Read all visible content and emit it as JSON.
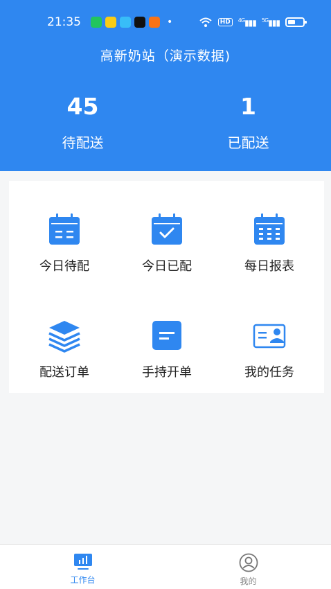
{
  "status_bar": {
    "time": "21:35",
    "dot": "•",
    "signal_1": "4G",
    "signal_2": "5G",
    "hd": "HD"
  },
  "header": {
    "title": "高新奶站（演示数据)",
    "stats": [
      {
        "value": "45",
        "label": "待配送"
      },
      {
        "value": "1",
        "label": "已配送"
      }
    ]
  },
  "grid": {
    "items": [
      {
        "label": "今日待配",
        "icon": "calendar-list-icon"
      },
      {
        "label": "今日已配",
        "icon": "calendar-check-icon"
      },
      {
        "label": "每日报表",
        "icon": "calendar-grid-icon"
      },
      {
        "label": "配送订单",
        "icon": "layers-icon"
      },
      {
        "label": "手持开单",
        "icon": "document-icon"
      },
      {
        "label": "我的任务",
        "icon": "id-card-icon"
      }
    ]
  },
  "tabbar": {
    "tabs": [
      {
        "label": "工作台",
        "icon": "dashboard-icon",
        "active": true
      },
      {
        "label": "我的",
        "icon": "user-icon",
        "active": false
      }
    ]
  },
  "colors": {
    "primary": "#2f87f0",
    "background": "#f5f6f7"
  }
}
